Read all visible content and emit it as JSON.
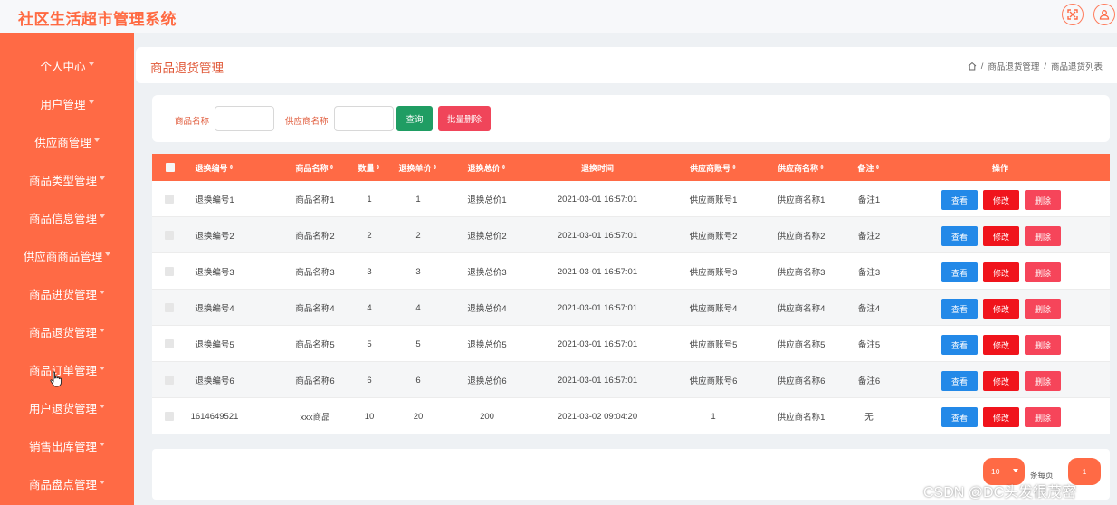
{
  "app": {
    "title": "社区生活超市管理系统"
  },
  "topbar": {
    "icons": [
      "fullscreen-icon",
      "user-icon"
    ]
  },
  "sidebar": {
    "items": [
      {
        "label": "个人中心"
      },
      {
        "label": "用户管理"
      },
      {
        "label": "供应商管理"
      },
      {
        "label": "商品类型管理"
      },
      {
        "label": "商品信息管理"
      },
      {
        "label": "供应商商品管理"
      },
      {
        "label": "商品进货管理"
      },
      {
        "label": "商品退货管理"
      },
      {
        "label": "商品订单管理"
      },
      {
        "label": "用户退货管理"
      },
      {
        "label": "销售出库管理"
      },
      {
        "label": "商品盘点管理"
      }
    ]
  },
  "header": {
    "title": "商品退货管理",
    "breadcrumb": [
      "商品退货管理",
      "商品退货列表"
    ]
  },
  "search": {
    "product_label": "商品名称",
    "supplier_label": "供应商名称",
    "query_button": "查询",
    "batch_delete_button": "批量删除"
  },
  "table": {
    "columns": [
      "退换编号",
      "商品名称",
      "数量",
      "退换单价",
      "退换总价",
      "退换时间",
      "供应商账号",
      "供应商名称",
      "备注",
      "操作"
    ],
    "rows": [
      [
        "退换编号1",
        "商品名称1",
        "1",
        "1",
        "退换总价1",
        "2021-03-01 16:57:01",
        "供应商账号1",
        "供应商名称1",
        "备注1"
      ],
      [
        "退换编号2",
        "商品名称2",
        "2",
        "2",
        "退换总价2",
        "2021-03-01 16:57:01",
        "供应商账号2",
        "供应商名称2",
        "备注2"
      ],
      [
        "退换编号3",
        "商品名称3",
        "3",
        "3",
        "退换总价3",
        "2021-03-01 16:57:01",
        "供应商账号3",
        "供应商名称3",
        "备注3"
      ],
      [
        "退换编号4",
        "商品名称4",
        "4",
        "4",
        "退换总价4",
        "2021-03-01 16:57:01",
        "供应商账号4",
        "供应商名称4",
        "备注4"
      ],
      [
        "退换编号5",
        "商品名称5",
        "5",
        "5",
        "退换总价5",
        "2021-03-01 16:57:01",
        "供应商账号5",
        "供应商名称5",
        "备注5"
      ],
      [
        "退换编号6",
        "商品名称6",
        "6",
        "6",
        "退换总价6",
        "2021-03-01 16:57:01",
        "供应商账号6",
        "供应商名称6",
        "备注6"
      ],
      [
        "1614649521",
        "xxx商品",
        "10",
        "20",
        "200",
        "2021-03-02 09:04:20",
        "1",
        "供应商名称1",
        "无"
      ]
    ],
    "actions": {
      "view": "查看",
      "edit": "修改",
      "delete": "删除"
    }
  },
  "pagination": {
    "page_size": "10",
    "per_page_label": "条每页",
    "current_page": "1"
  },
  "watermark": "CSDN @DC头发很茂密",
  "colors": {
    "accent": "#ff6a45",
    "query": "#1f9d63",
    "batch_delete": "#f0455a",
    "view": "#2389e8",
    "edit": "#f0141c",
    "delete": "#f6455a"
  }
}
